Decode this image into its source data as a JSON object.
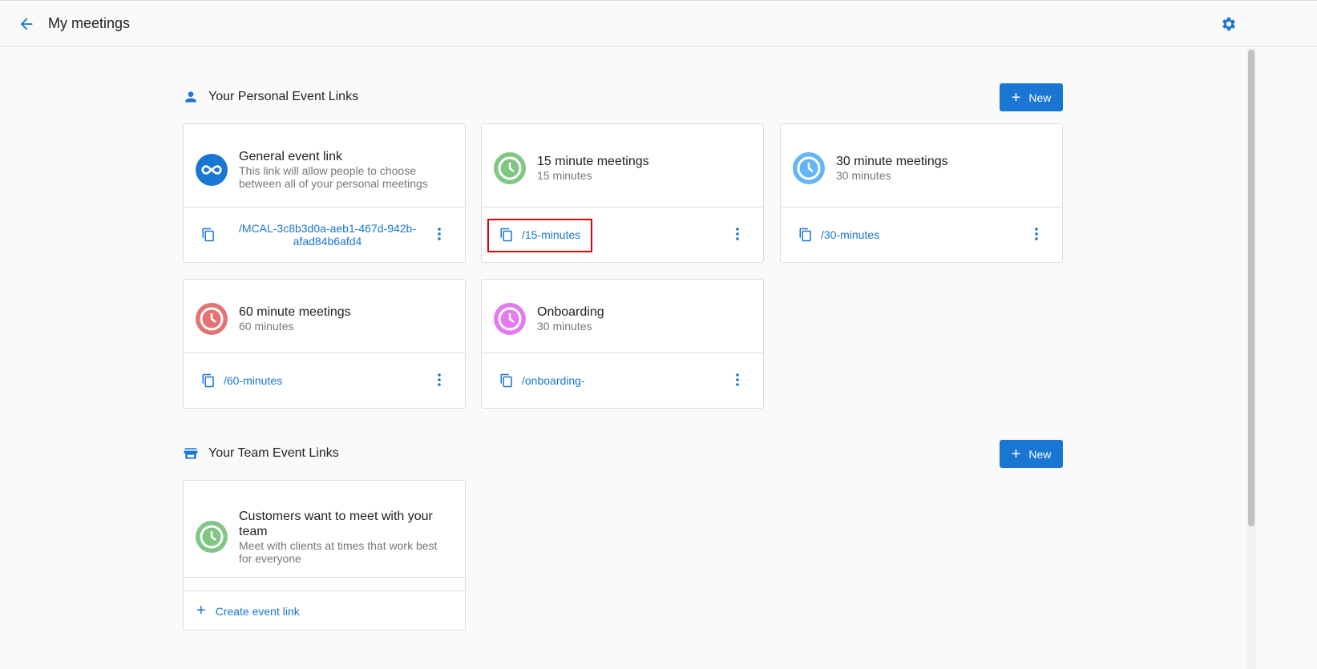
{
  "header": {
    "title": "My meetings"
  },
  "personal": {
    "title": "Your Personal Event Links",
    "new_label": "New",
    "cards": [
      {
        "title": "General event link",
        "subtitle": "This link will allow people to choose between all of your personal meetings",
        "link": "/MCAL-3c8b3d0a-aeb1-467d-942b-afad84b6afd4",
        "color": "#1976d2",
        "icon": "infinity-icon"
      },
      {
        "title": "15 minute meetings",
        "subtitle": "15 minutes",
        "link": "/15-minutes",
        "color": "#81c784",
        "icon": "clock-icon"
      },
      {
        "title": "30 minute meetings",
        "subtitle": "30 minutes",
        "link": "/30-minutes",
        "color": "#64b5f6",
        "icon": "clock-icon"
      },
      {
        "title": "60 minute meetings",
        "subtitle": "60 minutes",
        "link": "/60-minutes",
        "color": "#e57373",
        "icon": "clock-icon"
      },
      {
        "title": "Onboarding",
        "subtitle": "30 minutes",
        "link": "/onboarding-",
        "color": "#e27bf0",
        "icon": "clock-icon"
      }
    ]
  },
  "team": {
    "title": "Your Team Event Links",
    "new_label": "New",
    "card": {
      "title": "Customers want to meet with your team",
      "subtitle": "Meet with clients at times that work best for everyone",
      "create_label": "Create event link",
      "color": "#81c784"
    }
  }
}
